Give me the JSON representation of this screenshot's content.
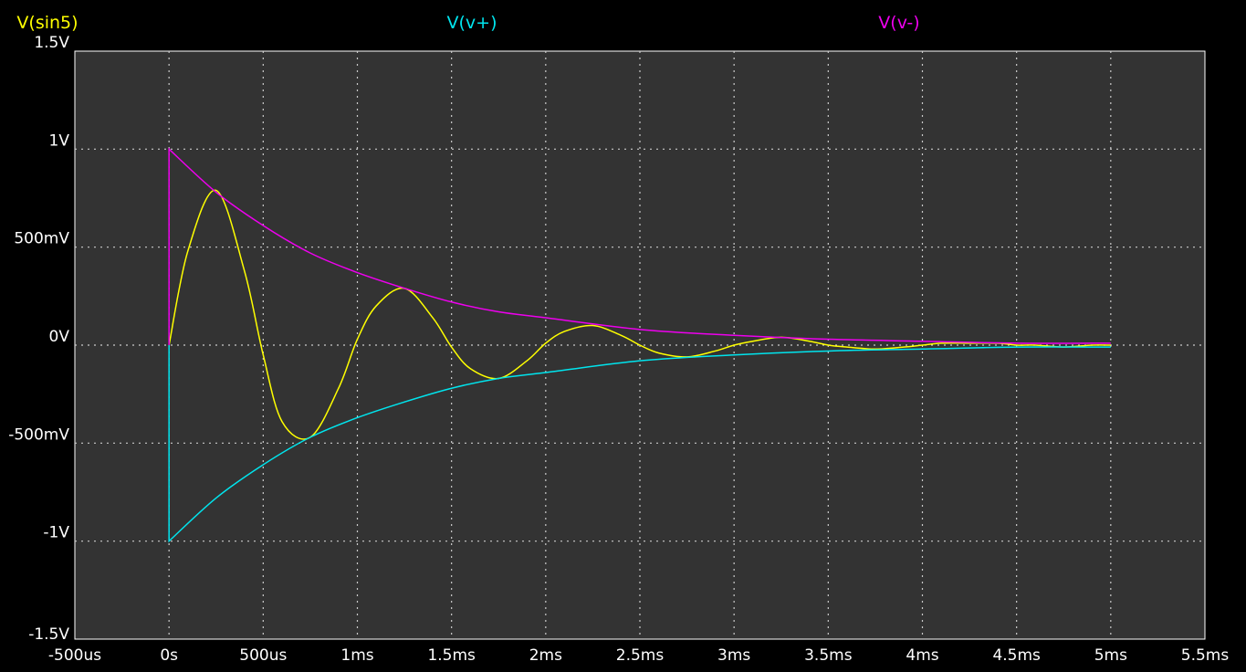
{
  "chart_data": {
    "type": "line",
    "xlabel": "",
    "ylabel": "",
    "xlim": [
      -0.0005,
      0.0055
    ],
    "ylim": [
      -1.5,
      1.5
    ],
    "grid": true,
    "background_color": "#000000",
    "plot_background_color": "#333333",
    "grid_color": "#cccccc",
    "x_ticks": [
      {
        "value": -0.0005,
        "label": "-500us"
      },
      {
        "value": 0,
        "label": "0s"
      },
      {
        "value": 0.0005,
        "label": "500us"
      },
      {
        "value": 0.001,
        "label": "1ms"
      },
      {
        "value": 0.0015,
        "label": "1.5ms"
      },
      {
        "value": 0.002,
        "label": "2ms"
      },
      {
        "value": 0.0025,
        "label": "2.5ms"
      },
      {
        "value": 0.003,
        "label": "3ms"
      },
      {
        "value": 0.0035,
        "label": "3.5ms"
      },
      {
        "value": 0.004,
        "label": "4ms"
      },
      {
        "value": 0.0045,
        "label": "4.5ms"
      },
      {
        "value": 0.005,
        "label": "5ms"
      },
      {
        "value": 0.0055,
        "label": "5.5ms"
      }
    ],
    "y_ticks": [
      {
        "value": 1.5,
        "label": "1.5V"
      },
      {
        "value": 1,
        "label": "1V"
      },
      {
        "value": 0.5,
        "label": "500mV"
      },
      {
        "value": 0,
        "label": "0V"
      },
      {
        "value": -0.5,
        "label": "-500mV"
      },
      {
        "value": -1,
        "label": "-1V"
      },
      {
        "value": -1.5,
        "label": "-1.5V"
      }
    ],
    "series": [
      {
        "name": "V(sin5)",
        "color": "#ffff00",
        "x": [
          0,
          0.0001,
          0.00025,
          0.0004,
          0.0005,
          0.0006,
          0.00075,
          0.0009,
          0.001,
          0.0011,
          0.00125,
          0.0014,
          0.0015,
          0.0016,
          0.00175,
          0.0019,
          0.002,
          0.0021,
          0.00225,
          0.0024,
          0.0025,
          0.0026,
          0.00275,
          0.0029,
          0.003,
          0.0031,
          0.00325,
          0.0034,
          0.0035,
          0.0036,
          0.00375,
          0.0039,
          0.004,
          0.0041,
          0.00425,
          0.0044,
          0.0045,
          0.0046,
          0.00475,
          0.0049,
          0.005
        ],
        "y": [
          0,
          0.48,
          0.79,
          0.38,
          -0.05,
          -0.39,
          -0.47,
          -0.22,
          0.03,
          0.2,
          0.29,
          0.14,
          -0.01,
          -0.12,
          -0.17,
          -0.08,
          0.01,
          0.07,
          0.1,
          0.05,
          0,
          -0.04,
          -0.06,
          -0.03,
          0,
          0.02,
          0.04,
          0.02,
          0,
          -0.01,
          -0.02,
          -0.01,
          0,
          0.01,
          0.01,
          0.01,
          0,
          0,
          -0.01,
          0,
          0
        ]
      },
      {
        "name": "V(v+)",
        "color": "#00e5ee",
        "x": [
          0,
          0,
          0.00025,
          0.0005,
          0.00075,
          0.001,
          0.00125,
          0.0015,
          0.00175,
          0.002,
          0.0025,
          0.003,
          0.0035,
          0.004,
          0.0045,
          0.005
        ],
        "y": [
          0,
          -1,
          -0.78,
          -0.61,
          -0.47,
          -0.37,
          -0.29,
          -0.22,
          -0.17,
          -0.14,
          -0.08,
          -0.05,
          -0.03,
          -0.02,
          -0.01,
          -0.01
        ]
      },
      {
        "name": "V(v-)",
        "color": "#ee00ee",
        "x": [
          0,
          0,
          0.00025,
          0.0005,
          0.00075,
          0.001,
          0.00125,
          0.0015,
          0.00175,
          0.002,
          0.0025,
          0.003,
          0.0035,
          0.004,
          0.0045,
          0.005
        ],
        "y": [
          0,
          1,
          0.78,
          0.61,
          0.47,
          0.37,
          0.29,
          0.22,
          0.17,
          0.14,
          0.08,
          0.05,
          0.03,
          0.02,
          0.01,
          0.01
        ]
      }
    ]
  }
}
